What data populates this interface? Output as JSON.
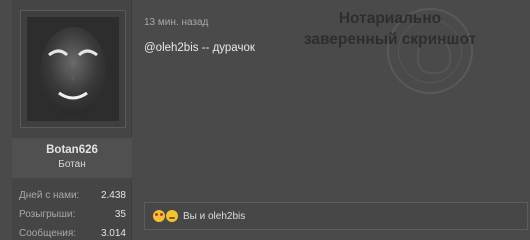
{
  "user": {
    "username": "Botan626",
    "title": "Ботан",
    "stats": [
      {
        "label": "Дней с нами:",
        "value": "2.438"
      },
      {
        "label": "Розыгрыши:",
        "value": "35"
      },
      {
        "label": "Сообщения:",
        "value": "3.014"
      }
    ]
  },
  "post": {
    "timestamp": "13 мин. назад",
    "mention": "@oleh2bis",
    "separator": " -- ",
    "text": "дурачок"
  },
  "stamp": {
    "line1": "Нотариально",
    "line2": "заверенный скриншот"
  },
  "reactions": {
    "text": "Вы и oleh2bis",
    "emoji": [
      "heart-eyes",
      "winking-face"
    ]
  }
}
